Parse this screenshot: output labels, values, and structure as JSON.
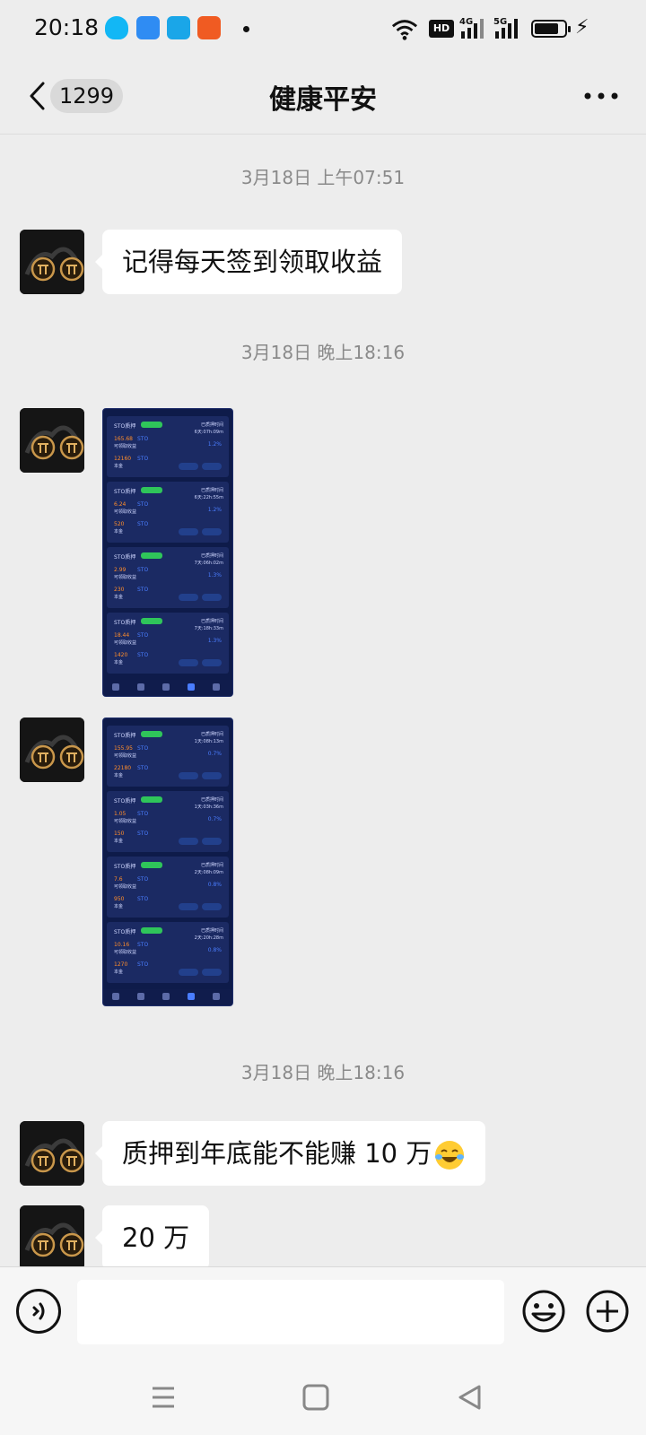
{
  "status_bar": {
    "time": "20:18",
    "notification_icons": [
      "qq-icon",
      "qq-mail-icon",
      "app-icon",
      "kuaishou-icon"
    ],
    "hd_label": "HD",
    "network_labels": [
      "4G",
      "5G"
    ],
    "battery_level": 0.8
  },
  "header": {
    "back_label": "1299",
    "title": "健康平安",
    "more_icon": "more-icon"
  },
  "messages": {
    "t1": "3月18日 上午07:51",
    "m1": "记得每天签到领取收益",
    "t2": "3月18日 晚上18:16",
    "img1": {
      "cards": [
        {
          "title": "STO质押",
          "info1": "已质押时间",
          "info2": "6天:07h:09m",
          "val1": "165.68",
          "val1_label": "可领取收益",
          "val2": "12160",
          "val2_label": "本金",
          "unit": "STO",
          "pct": "1.2%"
        },
        {
          "title": "STO质押",
          "info1": "已质押时间",
          "info2": "6天:22h:55m",
          "val1": "6.24",
          "val1_label": "可领取收益",
          "val2": "520",
          "val2_label": "本金",
          "unit": "STO",
          "pct": "1.2%"
        },
        {
          "title": "STO质押",
          "info1": "已质押时间",
          "info2": "7天:06h:02m",
          "val1": "2.99",
          "val1_label": "可领取收益",
          "val2": "230",
          "val2_label": "本金",
          "unit": "STO",
          "pct": "1.3%"
        },
        {
          "title": "STO质押",
          "info1": "已质押时间",
          "info2": "7天:18h:33m",
          "val1": "18.44",
          "val1_label": "可领取收益",
          "val2": "1420",
          "val2_label": "本金",
          "unit": "STO",
          "pct": "1.3%"
        }
      ]
    },
    "img2": {
      "cards": [
        {
          "title": "STO质押",
          "info1": "已质押时间",
          "info2": "1天:08h:13m",
          "val1": "155.95",
          "val1_label": "可领取收益",
          "val2": "22180",
          "val2_label": "本金",
          "unit": "STO",
          "pct": "0.7%"
        },
        {
          "title": "STO质押",
          "info1": "已质押时间",
          "info2": "1天:03h:36m",
          "val1": "1.05",
          "val1_label": "可领取收益",
          "val2": "150",
          "val2_label": "本金",
          "unit": "STO",
          "pct": "0.7%"
        },
        {
          "title": "STO质押",
          "info1": "已质押时间",
          "info2": "2天:08h:09m",
          "val1": "7.6",
          "val1_label": "可领取收益",
          "val2": "950",
          "val2_label": "本金",
          "unit": "STO",
          "pct": "0.8%"
        },
        {
          "title": "STO质押",
          "info1": "已质押时间",
          "info2": "2天:20h:28m",
          "val1": "10.16",
          "val1_label": "可领取收益",
          "val2": "1270",
          "val2_label": "本金",
          "unit": "STO",
          "pct": "0.8%"
        }
      ]
    },
    "t3": "3月18日 晚上18:16",
    "m2": "质押到年底能不能赚 10 万",
    "m2_emoji": "laughing-crying-emoji",
    "m3": "20 万"
  },
  "input": {
    "placeholder": "",
    "voice_icon": "voice-icon",
    "emoji_icon": "smiley-icon",
    "plus_icon": "plus-icon"
  },
  "system_nav": [
    "menu-icon",
    "home-icon",
    "back-triangle-icon"
  ]
}
